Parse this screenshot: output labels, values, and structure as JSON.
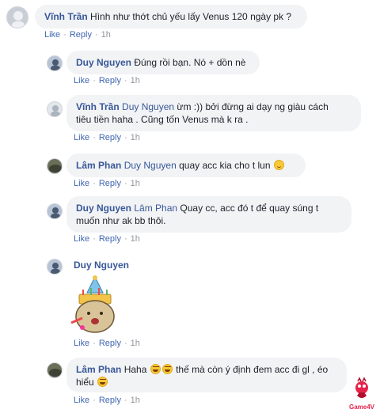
{
  "actions": {
    "like": "Like",
    "reply": "Reply",
    "dot": "·"
  },
  "comments": [
    {
      "name": "Vĩnh Trần",
      "tag": "",
      "text": "Hình như thớt chủ yếu lấy Venus 120 ngày pk ?",
      "time": "1h"
    },
    {
      "name": "Duy Nguyen",
      "tag": "",
      "text": "Đúng rồi bạn. Nó + dồn nè",
      "time": "1h"
    },
    {
      "name": "Vĩnh Trần",
      "tag": "Duy Nguyen",
      "text_line1": "ừm :)) bởi đừng ai dạy ng giàu cách",
      "text_line2": "tiêu tiền haha . Cũng tốn Venus mà k ra .",
      "time": "1h"
    },
    {
      "name": "Lâm Phan",
      "tag": "Duy Nguyen",
      "text": "quay acc kia cho t lun",
      "time": "1h"
    },
    {
      "name": "Duy Nguyen",
      "tag": "Lâm Phan",
      "text_line1": "Quay cc, acc đó t để quay súng t",
      "text_line2": "muốn như ak bb thôi.",
      "time": "1h"
    },
    {
      "name": "Duy Nguyen",
      "tag": "",
      "text": "",
      "time": "1h"
    },
    {
      "name": "Lâm Phan",
      "tag": "",
      "text_line1a": "Haha",
      "text_line1b": "thế mà còn ý định đem acc đi gl , éo",
      "text_line2": "hiểu",
      "time": "1h"
    }
  ],
  "watermark": {
    "text": "Game4V"
  },
  "colors": {
    "link": "#385898",
    "action": "#4267b2",
    "muted": "#90949c",
    "bubble": "#f2f3f5"
  }
}
